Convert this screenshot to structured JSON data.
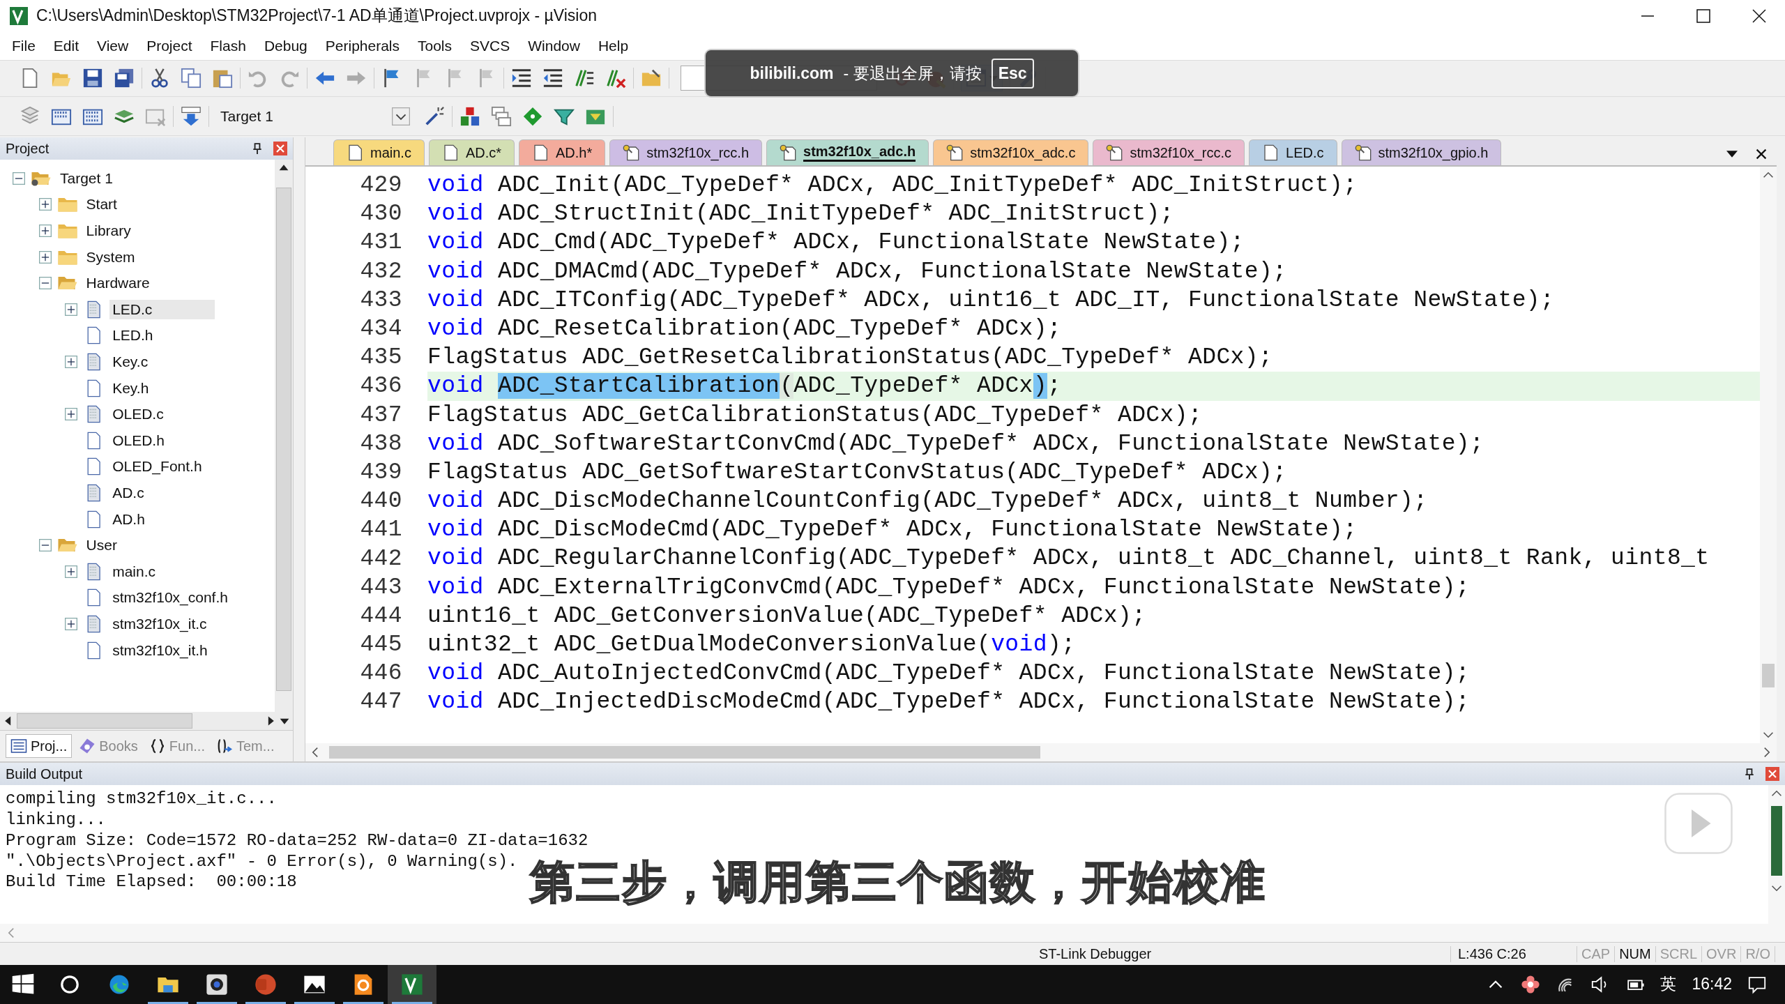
{
  "window": {
    "title": "C:\\Users\\Admin\\Desktop\\STM32Project\\7-1 AD单通道\\Project.uvprojx - µVision"
  },
  "menu": [
    "File",
    "Edit",
    "View",
    "Project",
    "Flash",
    "Debug",
    "Peripherals",
    "Tools",
    "SVCS",
    "Window",
    "Help"
  ],
  "toolbar": {
    "target": "Target 1"
  },
  "fullscreen_notice": {
    "site": "bilibili.com",
    "message": "- 要退出全屏，请按",
    "key": "Esc"
  },
  "project_panel": {
    "title": "Project",
    "tree": [
      {
        "label": "Target 1",
        "kind": "target",
        "expandable": true,
        "expanded": true,
        "selected": false,
        "children": [
          {
            "label": "Start",
            "kind": "folder",
            "expandable": true,
            "expanded": false,
            "selected": false
          },
          {
            "label": "Library",
            "kind": "folder",
            "expandable": true,
            "expanded": false,
            "selected": false
          },
          {
            "label": "System",
            "kind": "folder",
            "expandable": true,
            "expanded": false,
            "selected": false
          },
          {
            "label": "Hardware",
            "kind": "folder",
            "expandable": true,
            "expanded": true,
            "selected": false,
            "children": [
              {
                "label": "LED.c",
                "kind": "source",
                "expandable": true,
                "expanded": false,
                "selected": true
              },
              {
                "label": "LED.h",
                "kind": "header",
                "expandable": false,
                "selected": false
              },
              {
                "label": "Key.c",
                "kind": "source",
                "expandable": true,
                "expanded": false,
                "selected": false
              },
              {
                "label": "Key.h",
                "kind": "header",
                "expandable": false,
                "selected": false
              },
              {
                "label": "OLED.c",
                "kind": "source",
                "expandable": true,
                "expanded": false,
                "selected": false
              },
              {
                "label": "OLED.h",
                "kind": "header",
                "expandable": false,
                "selected": false
              },
              {
                "label": "OLED_Font.h",
                "kind": "header",
                "expandable": false,
                "selected": false
              },
              {
                "label": "AD.c",
                "kind": "source",
                "expandable": false,
                "selected": false
              },
              {
                "label": "AD.h",
                "kind": "header",
                "expandable": false,
                "selected": false
              }
            ]
          },
          {
            "label": "User",
            "kind": "folder",
            "expandable": true,
            "expanded": true,
            "selected": false,
            "children": [
              {
                "label": "main.c",
                "kind": "source",
                "expandable": true,
                "expanded": false,
                "selected": false
              },
              {
                "label": "stm32f10x_conf.h",
                "kind": "header",
                "expandable": false,
                "selected": false
              },
              {
                "label": "stm32f10x_it.c",
                "kind": "source",
                "expandable": true,
                "expanded": false,
                "selected": false
              },
              {
                "label": "stm32f10x_it.h",
                "kind": "header",
                "expandable": false,
                "selected": false
              }
            ]
          }
        ]
      }
    ],
    "tabs": [
      {
        "label": "Proj...",
        "selected": true
      },
      {
        "label": "Books",
        "selected": false
      },
      {
        "label": "Fun...",
        "selected": false
      },
      {
        "label": "Tem...",
        "selected": false
      }
    ]
  },
  "editor": {
    "tabs": [
      {
        "label": "main.c",
        "kind": "editable",
        "color": "#f7d97e",
        "selected": false
      },
      {
        "label": "AD.c*",
        "kind": "editable",
        "color": "#d3dfb3",
        "selected": false
      },
      {
        "label": "AD.h*",
        "kind": "editable",
        "color": "#f3ab9c",
        "selected": false
      },
      {
        "label": "stm32f10x_rcc.h",
        "kind": "read-only",
        "color": "#cdbde4",
        "selected": false
      },
      {
        "label": "stm32f10x_adc.h",
        "kind": "read-only",
        "color": "#b4dace",
        "selected": true
      },
      {
        "label": "stm32f10x_adc.c",
        "kind": "read-only",
        "color": "#f9c690",
        "selected": false
      },
      {
        "label": "stm32f10x_rcc.c",
        "kind": "read-only",
        "color": "#eab9cd",
        "selected": false
      },
      {
        "label": "LED.c",
        "kind": "editable",
        "color": "#b8cfe4",
        "selected": false
      },
      {
        "label": "stm32f10x_gpio.h",
        "kind": "read-only",
        "color": "#cdc1e1",
        "selected": false
      }
    ],
    "lines": [
      {
        "number": "429",
        "current": false,
        "segments": [
          {
            "text": "void",
            "kind": "keyword"
          },
          {
            "text": " ADC_Init(ADC_TypeDef* ADCx, ADC_InitTypeDef* ADC_InitStruct);",
            "kind": "plain"
          }
        ]
      },
      {
        "number": "430",
        "current": false,
        "segments": [
          {
            "text": "void",
            "kind": "keyword"
          },
          {
            "text": " ADC_StructInit(ADC_InitTypeDef* ADC_InitStruct);",
            "kind": "plain"
          }
        ]
      },
      {
        "number": "431",
        "current": false,
        "segments": [
          {
            "text": "void",
            "kind": "keyword"
          },
          {
            "text": " ADC_Cmd(ADC_TypeDef* ADCx, FunctionalState NewState);",
            "kind": "plain"
          }
        ]
      },
      {
        "number": "432",
        "current": false,
        "segments": [
          {
            "text": "void",
            "kind": "keyword"
          },
          {
            "text": " ADC_DMACmd(ADC_TypeDef* ADCx, FunctionalState NewState);",
            "kind": "plain"
          }
        ]
      },
      {
        "number": "433",
        "current": false,
        "segments": [
          {
            "text": "void",
            "kind": "keyword"
          },
          {
            "text": " ADC_ITConfig(ADC_TypeDef* ADCx, uint16_t ADC_IT, FunctionalState NewState);",
            "kind": "plain"
          }
        ]
      },
      {
        "number": "434",
        "current": false,
        "segments": [
          {
            "text": "void",
            "kind": "keyword"
          },
          {
            "text": " ADC_ResetCalibration(ADC_TypeDef* ADCx);",
            "kind": "plain"
          }
        ]
      },
      {
        "number": "435",
        "current": false,
        "segments": [
          {
            "text": "FlagStatus ADC_GetResetCalibrationStatus(ADC_TypeDef* ADCx);",
            "kind": "plain"
          }
        ]
      },
      {
        "number": "436",
        "current": true,
        "segments": [
          {
            "text": "void",
            "kind": "keyword"
          },
          {
            "text": "ADC_StartCalibration",
            "kind": "selected",
            "space_before": true
          },
          {
            "text": "(",
            "kind": "brace"
          },
          {
            "text": "ADC_TypeDef* ADCx",
            "kind": "plain"
          },
          {
            "text": ")",
            "kind": "match"
          },
          {
            "text": ";",
            "kind": "plain"
          }
        ]
      },
      {
        "number": "437",
        "current": false,
        "segments": [
          {
            "text": "FlagStatus ADC_GetCalibrationStatus(ADC_TypeDef* ADCx);",
            "kind": "plain"
          }
        ]
      },
      {
        "number": "438",
        "current": false,
        "segments": [
          {
            "text": "void",
            "kind": "keyword"
          },
          {
            "text": " ADC_SoftwareStartConvCmd(ADC_TypeDef* ADCx, FunctionalState NewState);",
            "kind": "plain"
          }
        ]
      },
      {
        "number": "439",
        "current": false,
        "segments": [
          {
            "text": "FlagStatus ADC_GetSoftwareStartConvStatus(ADC_TypeDef* ADCx);",
            "kind": "plain"
          }
        ]
      },
      {
        "number": "440",
        "current": false,
        "segments": [
          {
            "text": "void",
            "kind": "keyword"
          },
          {
            "text": " ADC_DiscModeChannelCountConfig(ADC_TypeDef* ADCx, uint8_t Number);",
            "kind": "plain"
          }
        ]
      },
      {
        "number": "441",
        "current": false,
        "segments": [
          {
            "text": "void",
            "kind": "keyword"
          },
          {
            "text": " ADC_DiscModeCmd(ADC_TypeDef* ADCx, FunctionalState NewState);",
            "kind": "plain"
          }
        ]
      },
      {
        "number": "442",
        "current": false,
        "segments": [
          {
            "text": "void",
            "kind": "keyword"
          },
          {
            "text": " ADC_RegularChannelConfig(ADC_TypeDef* ADCx, uint8_t ADC_Channel, uint8_t Rank, uint8_t",
            "kind": "plain"
          }
        ]
      },
      {
        "number": "443",
        "current": false,
        "segments": [
          {
            "text": "void",
            "kind": "keyword"
          },
          {
            "text": " ADC_ExternalTrigConvCmd(ADC_TypeDef* ADCx, FunctionalState NewState);",
            "kind": "plain"
          }
        ]
      },
      {
        "number": "444",
        "current": false,
        "segments": [
          {
            "text": "uint16_t ADC_GetConversionValue(ADC_TypeDef* ADCx);",
            "kind": "plain"
          }
        ]
      },
      {
        "number": "445",
        "current": false,
        "segments": [
          {
            "text": "uint32_t ADC_GetDualModeConversionValue(",
            "kind": "plain"
          },
          {
            "text": "void",
            "kind": "keyword"
          },
          {
            "text": ");",
            "kind": "plain"
          }
        ]
      },
      {
        "number": "446",
        "current": false,
        "segments": [
          {
            "text": "void",
            "kind": "keyword"
          },
          {
            "text": " ADC_AutoInjectedConvCmd(ADC_TypeDef* ADCx, FunctionalState NewState);",
            "kind": "plain"
          }
        ]
      },
      {
        "number": "447",
        "current": false,
        "segments": [
          {
            "text": "void",
            "kind": "keyword"
          },
          {
            "text": " ADC_InjectedDiscModeCmd(ADC_TypeDef* ADCx, FunctionalState NewState);",
            "kind": "plain"
          }
        ]
      }
    ]
  },
  "build_output": {
    "title": "Build Output",
    "lines": [
      "compiling stm32f10x_it.c...",
      "linking...",
      "Program Size: Code=1572 RO-data=252 RW-data=0 ZI-data=1632",
      "\".\\Objects\\Project.axf\" - 0 Error(s), 0 Warning(s).",
      "Build Time Elapsed:  00:00:18"
    ]
  },
  "subtitle": "第三步，调用第三个函数，开始校准",
  "status_bar": {
    "debugger": "ST-Link Debugger",
    "position": "L:436 C:26",
    "indicators": [
      {
        "label": "CAP",
        "on": false
      },
      {
        "label": "NUM",
        "on": true
      },
      {
        "label": "SCRL",
        "on": false
      },
      {
        "label": "OVR",
        "on": false
      },
      {
        "label": "R/O",
        "on": false
      }
    ]
  },
  "taskbar": {
    "apps": [
      {
        "running": false,
        "selected": false
      },
      {
        "running": true,
        "selected": false
      },
      {
        "running": true,
        "selected": false
      },
      {
        "running": true,
        "selected": false
      },
      {
        "running": true,
        "selected": false
      },
      {
        "running": true,
        "selected": false
      },
      {
        "running": true,
        "selected": true
      }
    ],
    "input_method": "英",
    "clock": "16:42"
  }
}
